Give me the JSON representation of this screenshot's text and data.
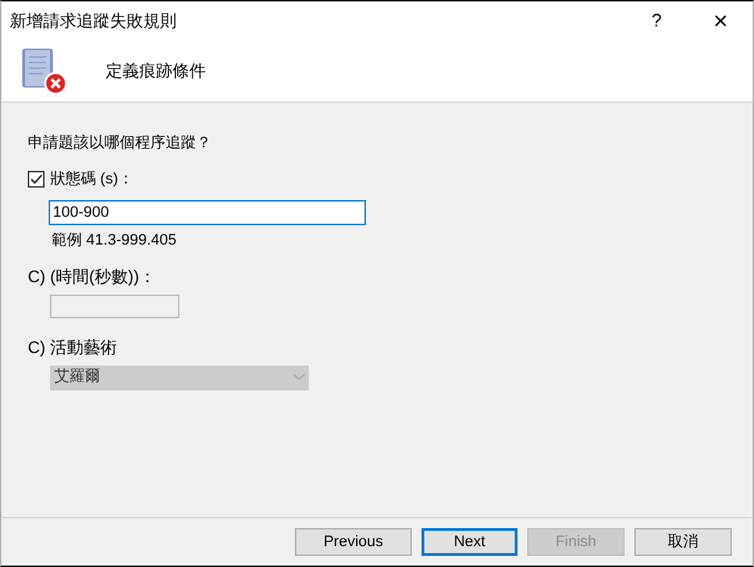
{
  "window": {
    "title": "新增請求追蹤失敗規則",
    "help": "?",
    "close": "×"
  },
  "header": {
    "title": "定義痕跡條件"
  },
  "question": "申請題該以哪個程序追蹤？",
  "status_code": {
    "label": "狀態碼 (s)：",
    "checked": true,
    "value": "100-900",
    "example": "範例 41.3-999.405"
  },
  "time_taken": {
    "label": "C) (時間(秒數))：",
    "disabled": true
  },
  "event_severity": {
    "label": "C) 活動藝術",
    "value": "艾羅爾",
    "disabled": true
  },
  "buttons": [
    {
      "label": "Previous",
      "kind": "normal"
    },
    {
      "label": "Next",
      "kind": "default"
    },
    {
      "label": "Finish",
      "kind": "disabled"
    },
    {
      "label": "取消",
      "kind": "normal"
    }
  ]
}
